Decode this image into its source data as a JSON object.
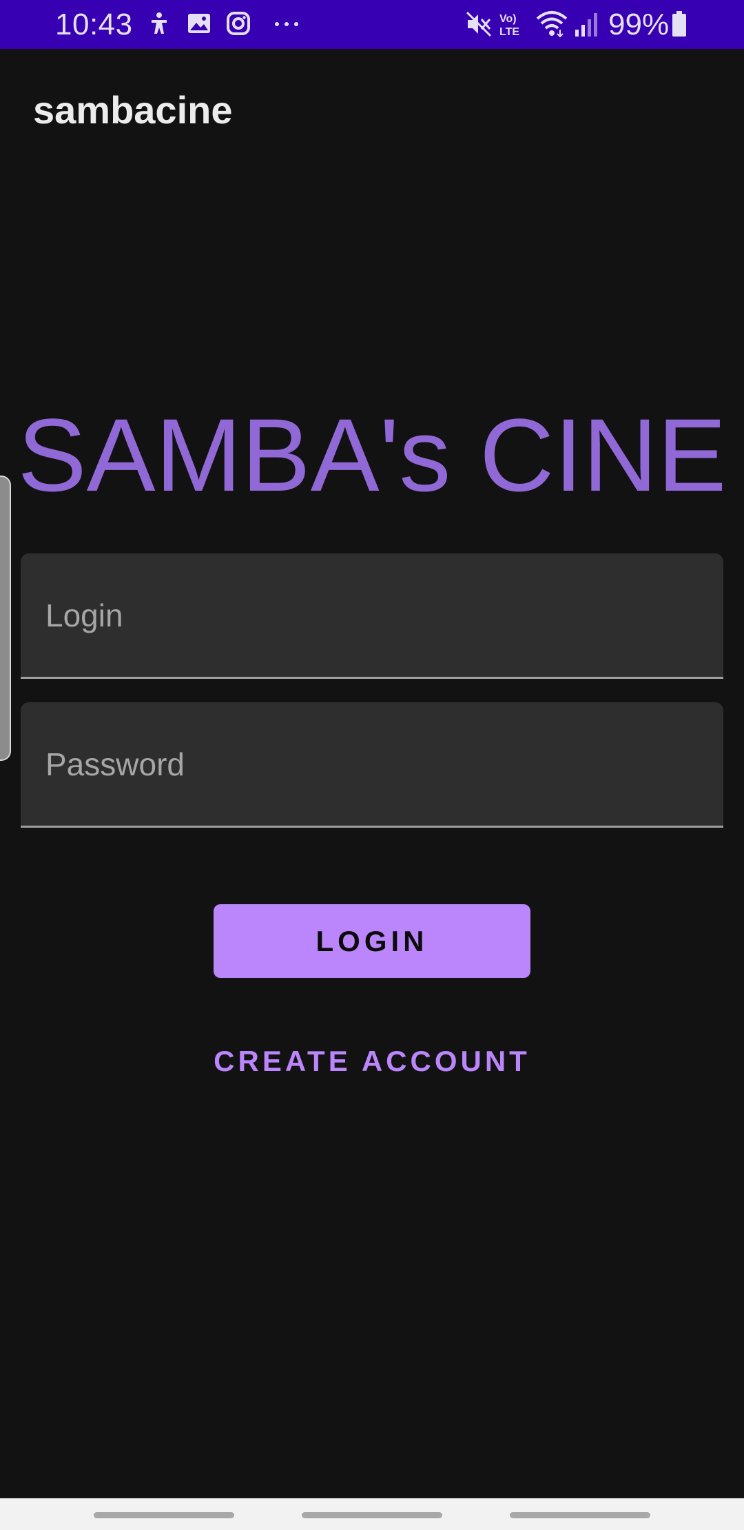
{
  "status_bar": {
    "time": "10:43",
    "battery_percent": "99%",
    "notification_icons": [
      "accessibility-icon",
      "image-icon",
      "instagram-icon",
      "more-dots-icon"
    ],
    "system_icons": [
      "mute-icon",
      "volte-icon",
      "wifi-icon",
      "signal-icon",
      "battery-icon"
    ],
    "volte_label": "Vo) LTE",
    "background_color": "#3700b3"
  },
  "app_bar": {
    "title": "sambacine"
  },
  "brand": {
    "title": "SAMBA's CINE",
    "color": "#9169d6"
  },
  "form": {
    "login_placeholder": "Login",
    "password_placeholder": "Password",
    "login_button_label": "LOGIN",
    "create_account_label": "CREATE ACCOUNT",
    "accent_color": "#bb86fc"
  },
  "nav_bar": {
    "items": [
      "recents-pill",
      "home-pill",
      "back-pill"
    ]
  }
}
